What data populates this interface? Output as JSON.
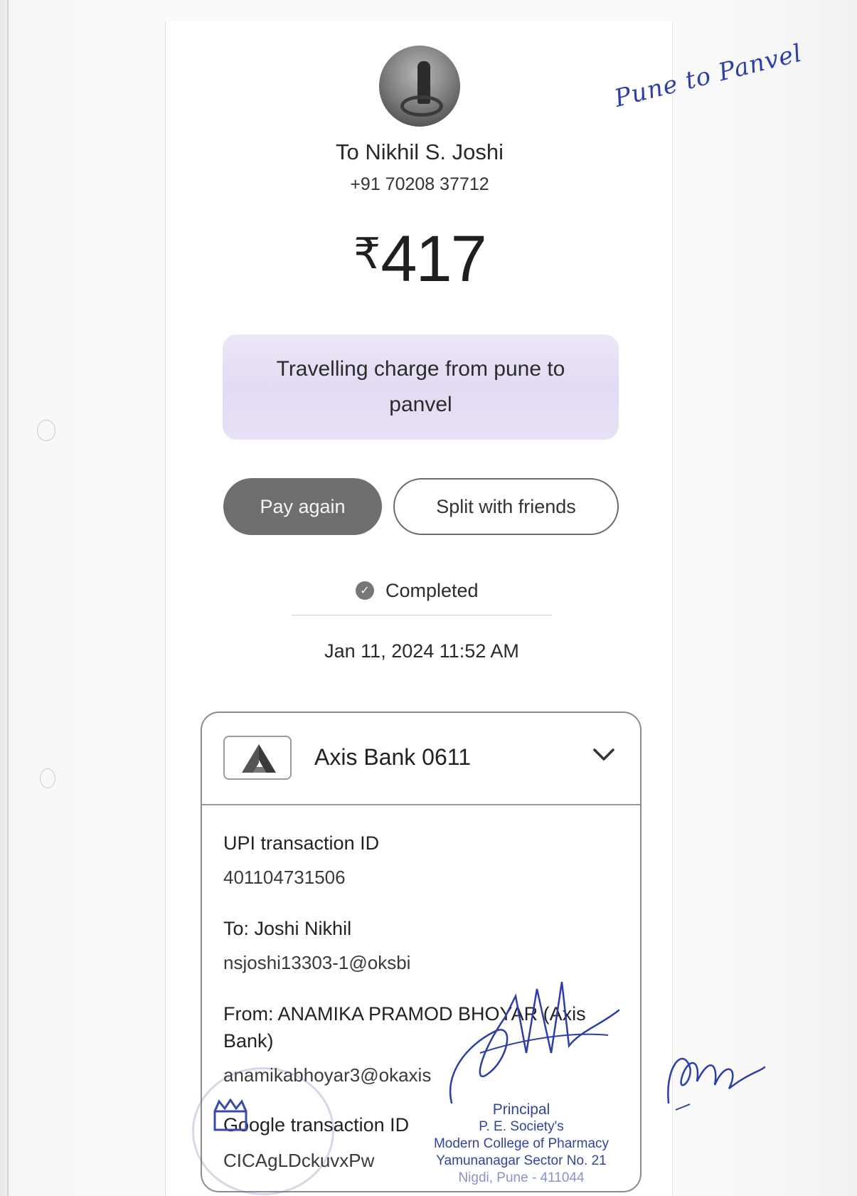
{
  "recipient": {
    "name": "To Nikhil S. Joshi",
    "phone": "+91 70208 37712"
  },
  "payment": {
    "currency_symbol": "₹",
    "amount": "417",
    "note": "Travelling charge from pune to panvel"
  },
  "actions": {
    "pay_again": "Pay again",
    "split": "Split with friends"
  },
  "status": {
    "label": "Completed",
    "datetime": "Jan 11, 2024 11:52 AM"
  },
  "card": {
    "bank_name": "Axis Bank 0611",
    "upi_label": "UPI transaction ID",
    "upi_id": "401104731506",
    "to_label": "To: Joshi  Nikhil",
    "to_upi": "nsjoshi13303-1@oksbi",
    "from_label_line1": "From: ANAMIKA PRAMOD BHOYAR (Axis",
    "from_label_line2": "Bank)",
    "from_upi": "anamikabhoyar3@okaxis",
    "google_label": "Google transaction ID",
    "google_id": "CICAgLDckuvxPw"
  },
  "annotations": {
    "handwritten_note": "Pune to Panvel",
    "stamp_title": "Principal",
    "stamp_line1": "P. E. Society's",
    "stamp_line2": "Modern College of Pharmacy",
    "stamp_line3": "Yamunanagar Sector No. 21",
    "stamp_line4": "Nigdi, Pune - 411044"
  },
  "icons": {
    "avatar": "profile-photo",
    "status": "check-circle-icon",
    "bank": "axis-bank-logo",
    "expand": "chevron-down-icon"
  },
  "colors": {
    "note_background": "#e6dff4",
    "pay_button": "#6f6f6f",
    "ink": "#2e3ea8"
  }
}
